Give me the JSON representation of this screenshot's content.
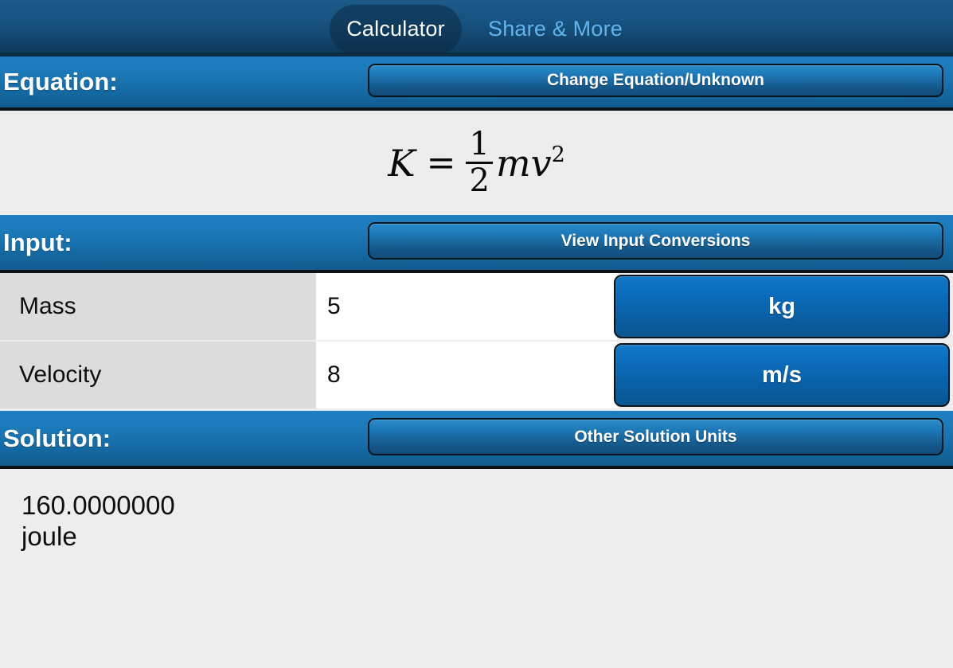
{
  "tabs": [
    {
      "label": "Calculator",
      "active": true
    },
    {
      "label": "Share & More",
      "active": false
    }
  ],
  "sections": {
    "equation": {
      "label": "Equation:",
      "button_label": "Change Equation/Unknown",
      "formula": {
        "lhs": "K",
        "equals": "=",
        "fraction_numerator": "1",
        "fraction_denominator": "2",
        "body": "mv",
        "exponent": "2",
        "plain_text": "K = 1/2 m v^2"
      }
    },
    "input": {
      "label": "Input:",
      "button_label": "View Input Conversions",
      "rows": [
        {
          "name": "Mass",
          "value": "5",
          "unit": "kg"
        },
        {
          "name": "Velocity",
          "value": "8",
          "unit": "m/s"
        }
      ]
    },
    "solution": {
      "label": "Solution:",
      "button_label": "Other Solution Units",
      "value": "160.0000000",
      "unit": "joule"
    }
  },
  "colors": {
    "tabbar_top": "#1c5a88",
    "tabbar_bottom": "#0e3553",
    "active_tab_bg": "#0f3a5c",
    "inactive_tab_text": "#61b4ee",
    "section_bar_top": "#1e7fc0",
    "section_bar_bottom": "#115c8e",
    "unit_button_top": "#1479c6",
    "unit_button_bottom": "#095590",
    "page_bg": "#ededed",
    "row_label_bg": "#dcdcdc",
    "row_value_bg": "#ffffff"
  }
}
